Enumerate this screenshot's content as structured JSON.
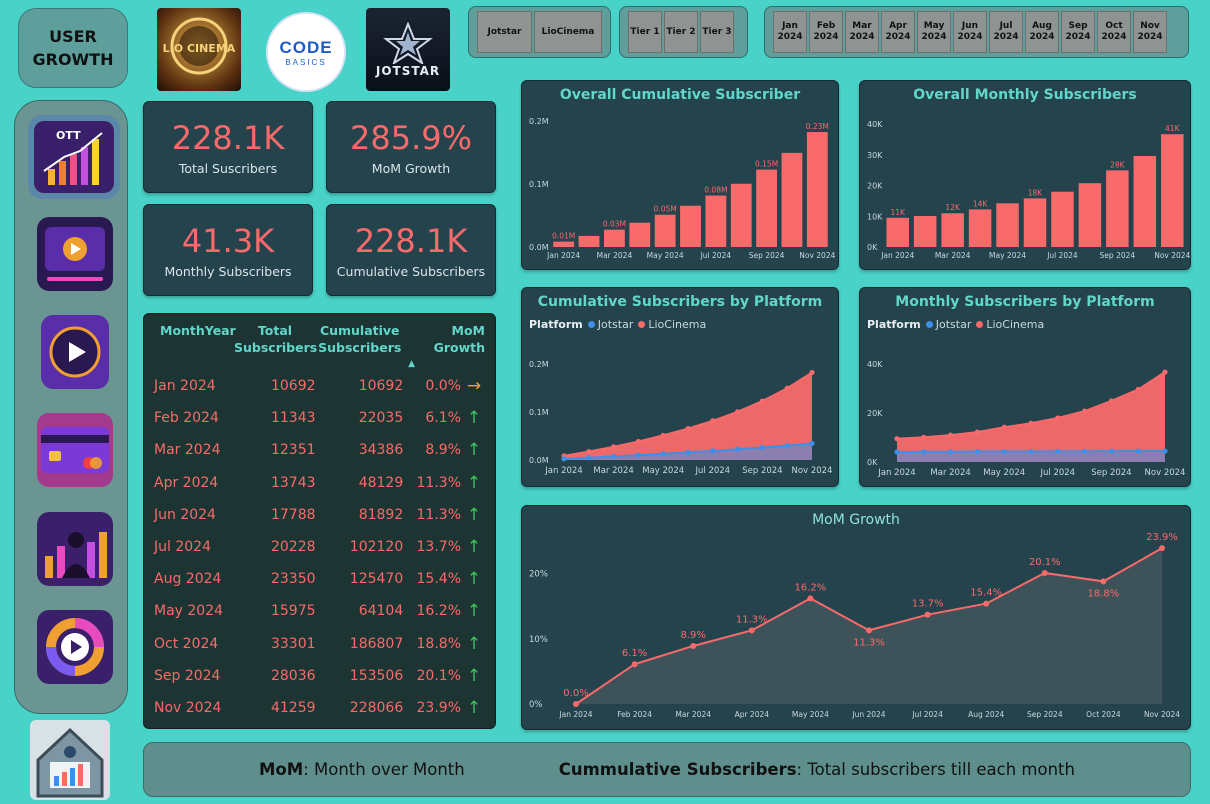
{
  "header": {
    "title": "USER\nGROWTH"
  },
  "logos": {
    "liocinema": "LIO CINEMA",
    "codebasics_a": "CODE",
    "codebasics_b": "BASICS",
    "jotstar": "JOTSTAR"
  },
  "slicers": {
    "platforms": [
      "Jotstar",
      "LioCinema"
    ],
    "tiers": [
      "Tier 1",
      "Tier 2",
      "Tier 3"
    ],
    "months": [
      "Jan 2024",
      "Feb 2024",
      "Mar 2024",
      "Apr 2024",
      "May 2024",
      "Jun 2024",
      "Jul 2024",
      "Aug 2024",
      "Sep 2024",
      "Oct 2024",
      "Nov 2024"
    ]
  },
  "nav": [
    "ott-growth-icon",
    "media-player-icon",
    "play-button-icon",
    "credit-card-icon",
    "user-chart-icon",
    "donut-play-icon",
    "home-analytics-icon"
  ],
  "kpis": {
    "total": {
      "value": "228.1K",
      "label": "Total Suscribers"
    },
    "mom": {
      "value": "285.9%",
      "label": "MoM Growth"
    },
    "monthly": {
      "value": "41.3K",
      "label": "Monthly Subscribers"
    },
    "cumulative": {
      "value": "228.1K",
      "label": "Cumulative Subscribers"
    }
  },
  "table": {
    "headers": [
      "MonthYear",
      "Total Subscribers",
      "Cumulative Subscribers",
      "MoM Growth"
    ],
    "rows": [
      {
        "month": "Jan 2024",
        "total": "10692",
        "cum": "10692",
        "mom": "0.0%",
        "trend": "flat"
      },
      {
        "month": "Feb 2024",
        "total": "11343",
        "cum": "22035",
        "mom": "6.1%",
        "trend": "up"
      },
      {
        "month": "Mar 2024",
        "total": "12351",
        "cum": "34386",
        "mom": "8.9%",
        "trend": "up"
      },
      {
        "month": "Apr 2024",
        "total": "13743",
        "cum": "48129",
        "mom": "11.3%",
        "trend": "up"
      },
      {
        "month": "Jun 2024",
        "total": "17788",
        "cum": "81892",
        "mom": "11.3%",
        "trend": "up"
      },
      {
        "month": "Jul 2024",
        "total": "20228",
        "cum": "102120",
        "mom": "13.7%",
        "trend": "up"
      },
      {
        "month": "Aug 2024",
        "total": "23350",
        "cum": "125470",
        "mom": "15.4%",
        "trend": "up"
      },
      {
        "month": "May 2024",
        "total": "15975",
        "cum": "64104",
        "mom": "16.2%",
        "trend": "up"
      },
      {
        "month": "Oct 2024",
        "total": "33301",
        "cum": "186807",
        "mom": "18.8%",
        "trend": "up"
      },
      {
        "month": "Sep 2024",
        "total": "28036",
        "cum": "153506",
        "mom": "20.1%",
        "trend": "up"
      },
      {
        "month": "Nov 2024",
        "total": "41259",
        "cum": "228066",
        "mom": "23.9%",
        "trend": "up"
      }
    ]
  },
  "footer": {
    "mom_term": "MoM",
    "mom_def": " : Month over Month",
    "cum_term": "Cummulative Subscribers",
    "cum_def": " : Total subscribers till each month"
  },
  "colors": {
    "accent": "#62d6cb",
    "bar": "#f96a6a",
    "jotstar": "#3d8fe8",
    "liocinema": "#f96a6a",
    "up": "#3fbf5f",
    "flat": "#f0a030"
  },
  "chart_data": [
    {
      "type": "bar",
      "title": "Overall Cumulative Subscriber",
      "categories": [
        "Jan 2024",
        "Feb 2024",
        "Mar 2024",
        "Apr 2024",
        "May 2024",
        "Jun 2024",
        "Jul 2024",
        "Aug 2024",
        "Sep 2024",
        "Oct 2024",
        "Nov 2024"
      ],
      "values": [
        10692,
        22035,
        34386,
        48129,
        64104,
        81892,
        102120,
        125470,
        153506,
        186807,
        228066
      ],
      "data_labels": [
        "0.01M",
        "",
        "0.03M",
        "",
        "0.05M",
        "",
        "0.08M",
        "",
        "0.15M",
        "",
        "0.23M"
      ],
      "tick_labels_x": [
        "Jan 2024",
        "Mar 2024",
        "May 2024",
        "Jul 2024",
        "Sep 2024",
        "Nov 2024"
      ],
      "yticks": [
        "0.0M",
        "0.1M",
        "0.2M"
      ],
      "ylim": [
        0,
        250000
      ]
    },
    {
      "type": "bar",
      "title": "Overall Monthly Subscribers",
      "categories": [
        "Jan 2024",
        "Feb 2024",
        "Mar 2024",
        "Apr 2024",
        "May 2024",
        "Jun 2024",
        "Jul 2024",
        "Aug 2024",
        "Sep 2024",
        "Oct 2024",
        "Nov 2024"
      ],
      "values": [
        10692,
        11343,
        12351,
        13743,
        15975,
        17788,
        20228,
        23350,
        28036,
        33301,
        41259
      ],
      "data_labels": [
        "11K",
        "",
        "12K",
        "14K",
        "",
        "18K",
        "",
        "",
        "28K",
        "",
        "41K"
      ],
      "tick_labels_x": [
        "Jan 2024",
        "Mar 2024",
        "May 2024",
        "Jul 2024",
        "Sep 2024",
        "Nov 2024"
      ],
      "yticks": [
        "0K",
        "10K",
        "20K",
        "30K",
        "40K"
      ],
      "ylim": [
        0,
        45000
      ]
    },
    {
      "type": "area",
      "title": "Cumulative Subscribers by Platform",
      "legend_title": "Platform",
      "categories": [
        "Jan 2024",
        "Feb 2024",
        "Mar 2024",
        "Apr 2024",
        "May 2024",
        "Jun 2024",
        "Jul 2024",
        "Aug 2024",
        "Sep 2024",
        "Oct 2024",
        "Nov 2024"
      ],
      "series": [
        {
          "name": "Jotstar",
          "values": [
            3000,
            6000,
            9300,
            12700,
            16200,
            19900,
            23800,
            28000,
            32600,
            37600,
            43200
          ]
        },
        {
          "name": "LioCinema",
          "values": [
            10692,
            22035,
            34386,
            48129,
            64104,
            81892,
            102120,
            125470,
            153506,
            186807,
            228066
          ]
        }
      ],
      "tick_labels_x": [
        "Jan 2024",
        "Mar 2024",
        "May 2024",
        "Jul 2024",
        "Sep 2024",
        "Nov 2024"
      ],
      "yticks": [
        "0.0M",
        "0.1M",
        "0.2M"
      ],
      "ylim": [
        0,
        250000
      ]
    },
    {
      "type": "area",
      "title": "Monthly Subscribers by Platform",
      "legend_title": "Platform",
      "categories": [
        "Jan 2024",
        "Feb 2024",
        "Mar 2024",
        "Apr 2024",
        "May 2024",
        "Jun 2024",
        "Jul 2024",
        "Aug 2024",
        "Sep 2024",
        "Oct 2024",
        "Nov 2024"
      ],
      "series": [
        {
          "name": "Jotstar",
          "values": [
            4600,
            4700,
            4700,
            4800,
            4800,
            4800,
            4900,
            4900,
            5000,
            5000,
            5000
          ]
        },
        {
          "name": "LioCinema",
          "values": [
            10692,
            11343,
            12351,
            13743,
            15975,
            17788,
            20228,
            23350,
            28036,
            33301,
            41259
          ]
        }
      ],
      "tick_labels_x": [
        "Jan 2024",
        "Mar 2024",
        "May 2024",
        "Jul 2024",
        "Sep 2024",
        "Nov 2024"
      ],
      "yticks": [
        "0K",
        "20K",
        "40K"
      ],
      "ylim": [
        0,
        45000
      ]
    },
    {
      "type": "line",
      "title": "MoM Growth",
      "categories": [
        "Jan 2024",
        "Feb 2024",
        "Mar 2024",
        "Apr 2024",
        "May 2024",
        "Jun 2024",
        "Jul 2024",
        "Aug 2024",
        "Sep 2024",
        "Oct 2024",
        "Nov 2024"
      ],
      "values": [
        0.0,
        6.1,
        8.9,
        11.3,
        16.2,
        11.3,
        13.7,
        15.4,
        20.1,
        18.8,
        23.9
      ],
      "data_labels": [
        "0.0%",
        "6.1%",
        "8.9%",
        "11.3%",
        "16.2%",
        "11.3%",
        "13.7%",
        "15.4%",
        "20.1%",
        "18.8%",
        "23.9%"
      ],
      "yticks": [
        "0%",
        "10%",
        "20%"
      ],
      "ylim": [
        0,
        25
      ]
    }
  ]
}
